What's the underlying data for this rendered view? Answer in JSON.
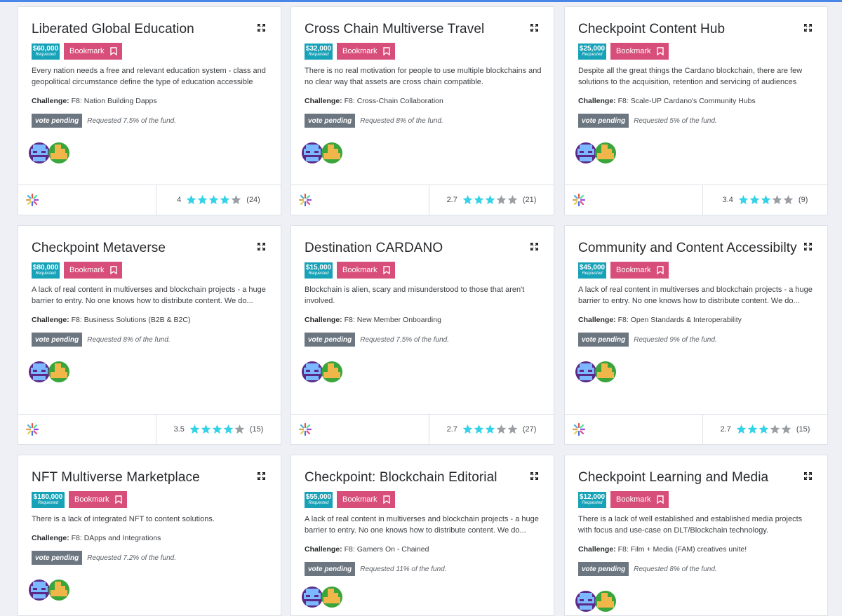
{
  "requested_label": "Requested",
  "bookmark_label": "Bookmark",
  "challenge_label": "Challenge:",
  "status_label": "vote pending",
  "colors": {
    "accent": "#17a2b8",
    "bookmark": "#d84e7b",
    "star": "#33d2e6",
    "star_empty": "#9a9ea3",
    "pending": "#6c7680"
  },
  "cards": [
    {
      "title": "Liberated Global Education",
      "amount": "$60,000",
      "desc": "Every nation needs a free and relevant education system - class and geopolitical circumstance define the type of education accessible",
      "challenge": "F8: Nation Building Dapps",
      "fund_text": "Requested 7.5% of the fund.",
      "score": "4",
      "rating": 4,
      "votes": "(24)"
    },
    {
      "title": "Cross Chain Multiverse Travel",
      "amount": "$32,000",
      "desc": "There is no real motivation for people to use multiple blockchains and no clear way that assets are cross chain compatible.",
      "challenge": "F8: Cross-Chain Collaboration",
      "fund_text": "Requested 8% of the fund.",
      "score": "2.7",
      "rating": 3,
      "votes": "(21)"
    },
    {
      "title": "Checkpoint Content Hub",
      "amount": "$25,000",
      "desc": "Despite all the great things the Cardano blockchain, there are few solutions to the acquisition, retention and servicing of audiences",
      "challenge": "F8: Scale-UP Cardano's Community Hubs",
      "fund_text": "Requested 5% of the fund.",
      "score": "3.4",
      "rating": 3,
      "votes": "(9)"
    },
    {
      "title": "Checkpoint Metaverse",
      "amount": "$80,000",
      "desc": "A lack of real content in multiverses and blockchain projects - a huge barrier to entry. No one knows how to distribute content. We do...",
      "challenge": "F8: Business Solutions (B2B & B2C)",
      "fund_text": "Requested 8% of the fund.",
      "score": "3.5",
      "rating": 4,
      "votes": "(15)"
    },
    {
      "title": "Destination CARDANO",
      "amount": "$15,000",
      "desc": "Blockchain is alien, scary and misunderstood to those that aren't involved.",
      "challenge": "F8: New Member Onboarding",
      "fund_text": "Requested 7.5% of the fund.",
      "score": "2.7",
      "rating": 3,
      "votes": "(27)"
    },
    {
      "title": "Community and Content Accessibilty",
      "amount": "$45,000",
      "desc": "A lack of real content in multiverses and blockchain projects - a huge barrier to entry. No one knows how to distribute content. We do...",
      "challenge": "F8: Open Standards & Interoperability",
      "fund_text": "Requested 9% of the fund.",
      "score": "2.7",
      "rating": 3,
      "votes": "(15)"
    },
    {
      "title": "NFT Multiverse Marketplace",
      "amount": "$180,000",
      "desc": "There is a lack of integrated NFT to content solutions.",
      "challenge": "F8: DApps and Integrations",
      "fund_text": "Requested 7.2% of the fund."
    },
    {
      "title": "Checkpoint: Blockchain Editorial",
      "amount": "$55,000",
      "desc": "A lack of real content in multiverses and blockchain projects - a huge barrier to entry. No one knows how to distribute content. We do...",
      "challenge": "F8: Gamers On - Chained",
      "fund_text": "Requested 11% of the fund."
    },
    {
      "title": "Checkpoint Learning and Media",
      "amount": "$12,000",
      "desc": "There is a lack of well established and established media projects with focus and use-case on DLT/Blockchain technology.",
      "challenge": "F8: Film + Media (FAM) creatives unite!",
      "fund_text": "Requested 8% of the fund."
    }
  ]
}
